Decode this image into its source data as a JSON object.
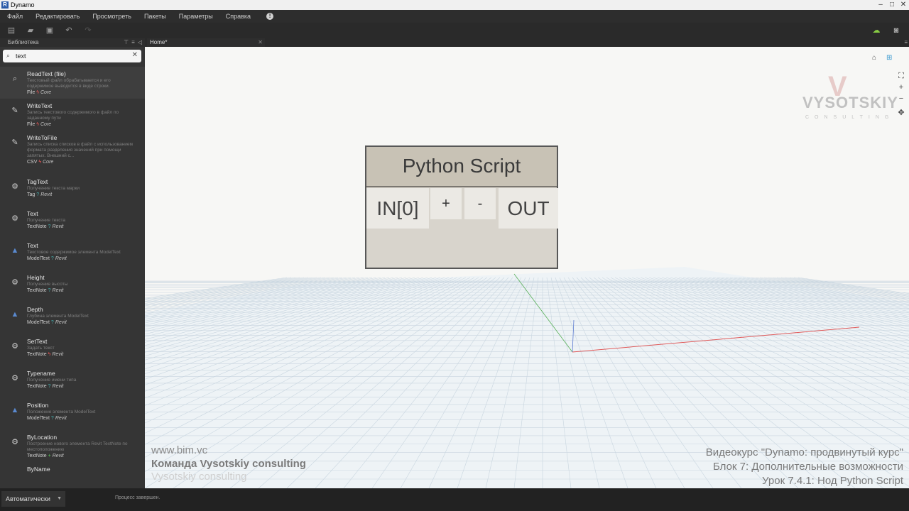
{
  "window": {
    "title": "Dynamo",
    "logo_letter": "R"
  },
  "window_buttons": {
    "minimize": "–",
    "maximize": "□",
    "close": "✕"
  },
  "menu": [
    "Файл",
    "Редактировать",
    "Просмотреть",
    "Пакеты",
    "Параметры",
    "Справка"
  ],
  "toolbar_icons": [
    "new-file-icon",
    "open-file-icon",
    "save-icon",
    "undo-icon",
    "redo-icon"
  ],
  "library": {
    "title": "Библиотека",
    "search_value": "text",
    "items": [
      {
        "name": "ReadText (file)",
        "desc": "Текстовый файл обрабатывается и его содержимое выводится в виде строки.",
        "cat": "File",
        "badge": "bolt",
        "group": "Core"
      },
      {
        "name": "WriteText",
        "desc": "Запись текстового содержимого в файл по заданному пути",
        "cat": "File",
        "badge": "bolt",
        "group": "Core"
      },
      {
        "name": "WriteToFile",
        "desc": "Запись списка списков в файл с использованием формата разделения значений при помощи запятых. Внешний с...",
        "cat": "CSV",
        "badge": "bolt",
        "group": "Core"
      },
      {
        "name": "TagText",
        "desc": "Получение текста марки",
        "cat": "Tag",
        "badge": "q",
        "group": "Revit"
      },
      {
        "name": "Text",
        "desc": "Получение текста",
        "cat": "TextNote",
        "badge": "q",
        "group": "Revit"
      },
      {
        "name": "Text",
        "desc": "Текстовое содержимое элемента ModelText",
        "cat": "ModelText",
        "badge": "q",
        "group": "Revit"
      },
      {
        "name": "Height",
        "desc": "Получение высоты",
        "cat": "TextNote",
        "badge": "q",
        "group": "Revit"
      },
      {
        "name": "Depth",
        "desc": "Глубина элемента ModelText",
        "cat": "ModelText",
        "badge": "q",
        "group": "Revit"
      },
      {
        "name": "SetText",
        "desc": "Задать текст",
        "cat": "TextNote",
        "badge": "bolt",
        "group": "Revit"
      },
      {
        "name": "Typename",
        "desc": "Получение имени типа",
        "cat": "TextNote",
        "badge": "q",
        "group": "Revit"
      },
      {
        "name": "Position",
        "desc": "Положение элемента ModelText",
        "cat": "ModelText",
        "badge": "q",
        "group": "Revit"
      },
      {
        "name": "ByLocation",
        "desc": "Построение нового элемента Revit TextNote по местоположению",
        "cat": "TextNote",
        "badge": "plus",
        "group": "Revit"
      },
      {
        "name": "ByName",
        "desc": "",
        "cat": "",
        "badge": "",
        "group": ""
      }
    ]
  },
  "tabs": [
    {
      "label": "Home*"
    }
  ],
  "node": {
    "title": "Python Script",
    "input": "IN[0]",
    "add": "+",
    "remove": "-",
    "output": "OUT"
  },
  "watermark": {
    "brand": "VYSOTSKIY",
    "sub": "CONSULTING"
  },
  "captions": {
    "left": [
      "www.bim.vc",
      "Команда Vysotskiy consulting",
      "Vysotskiy consulting"
    ],
    "right": [
      "Видеокурс \"Dynamo: продвинутый курс\"",
      "Блок 7: Дополнительные возможности",
      "Урок 7.4.1: Нод Python Script"
    ]
  },
  "status": {
    "run_mode": "Автоматически",
    "message": "Процесс завершен."
  }
}
